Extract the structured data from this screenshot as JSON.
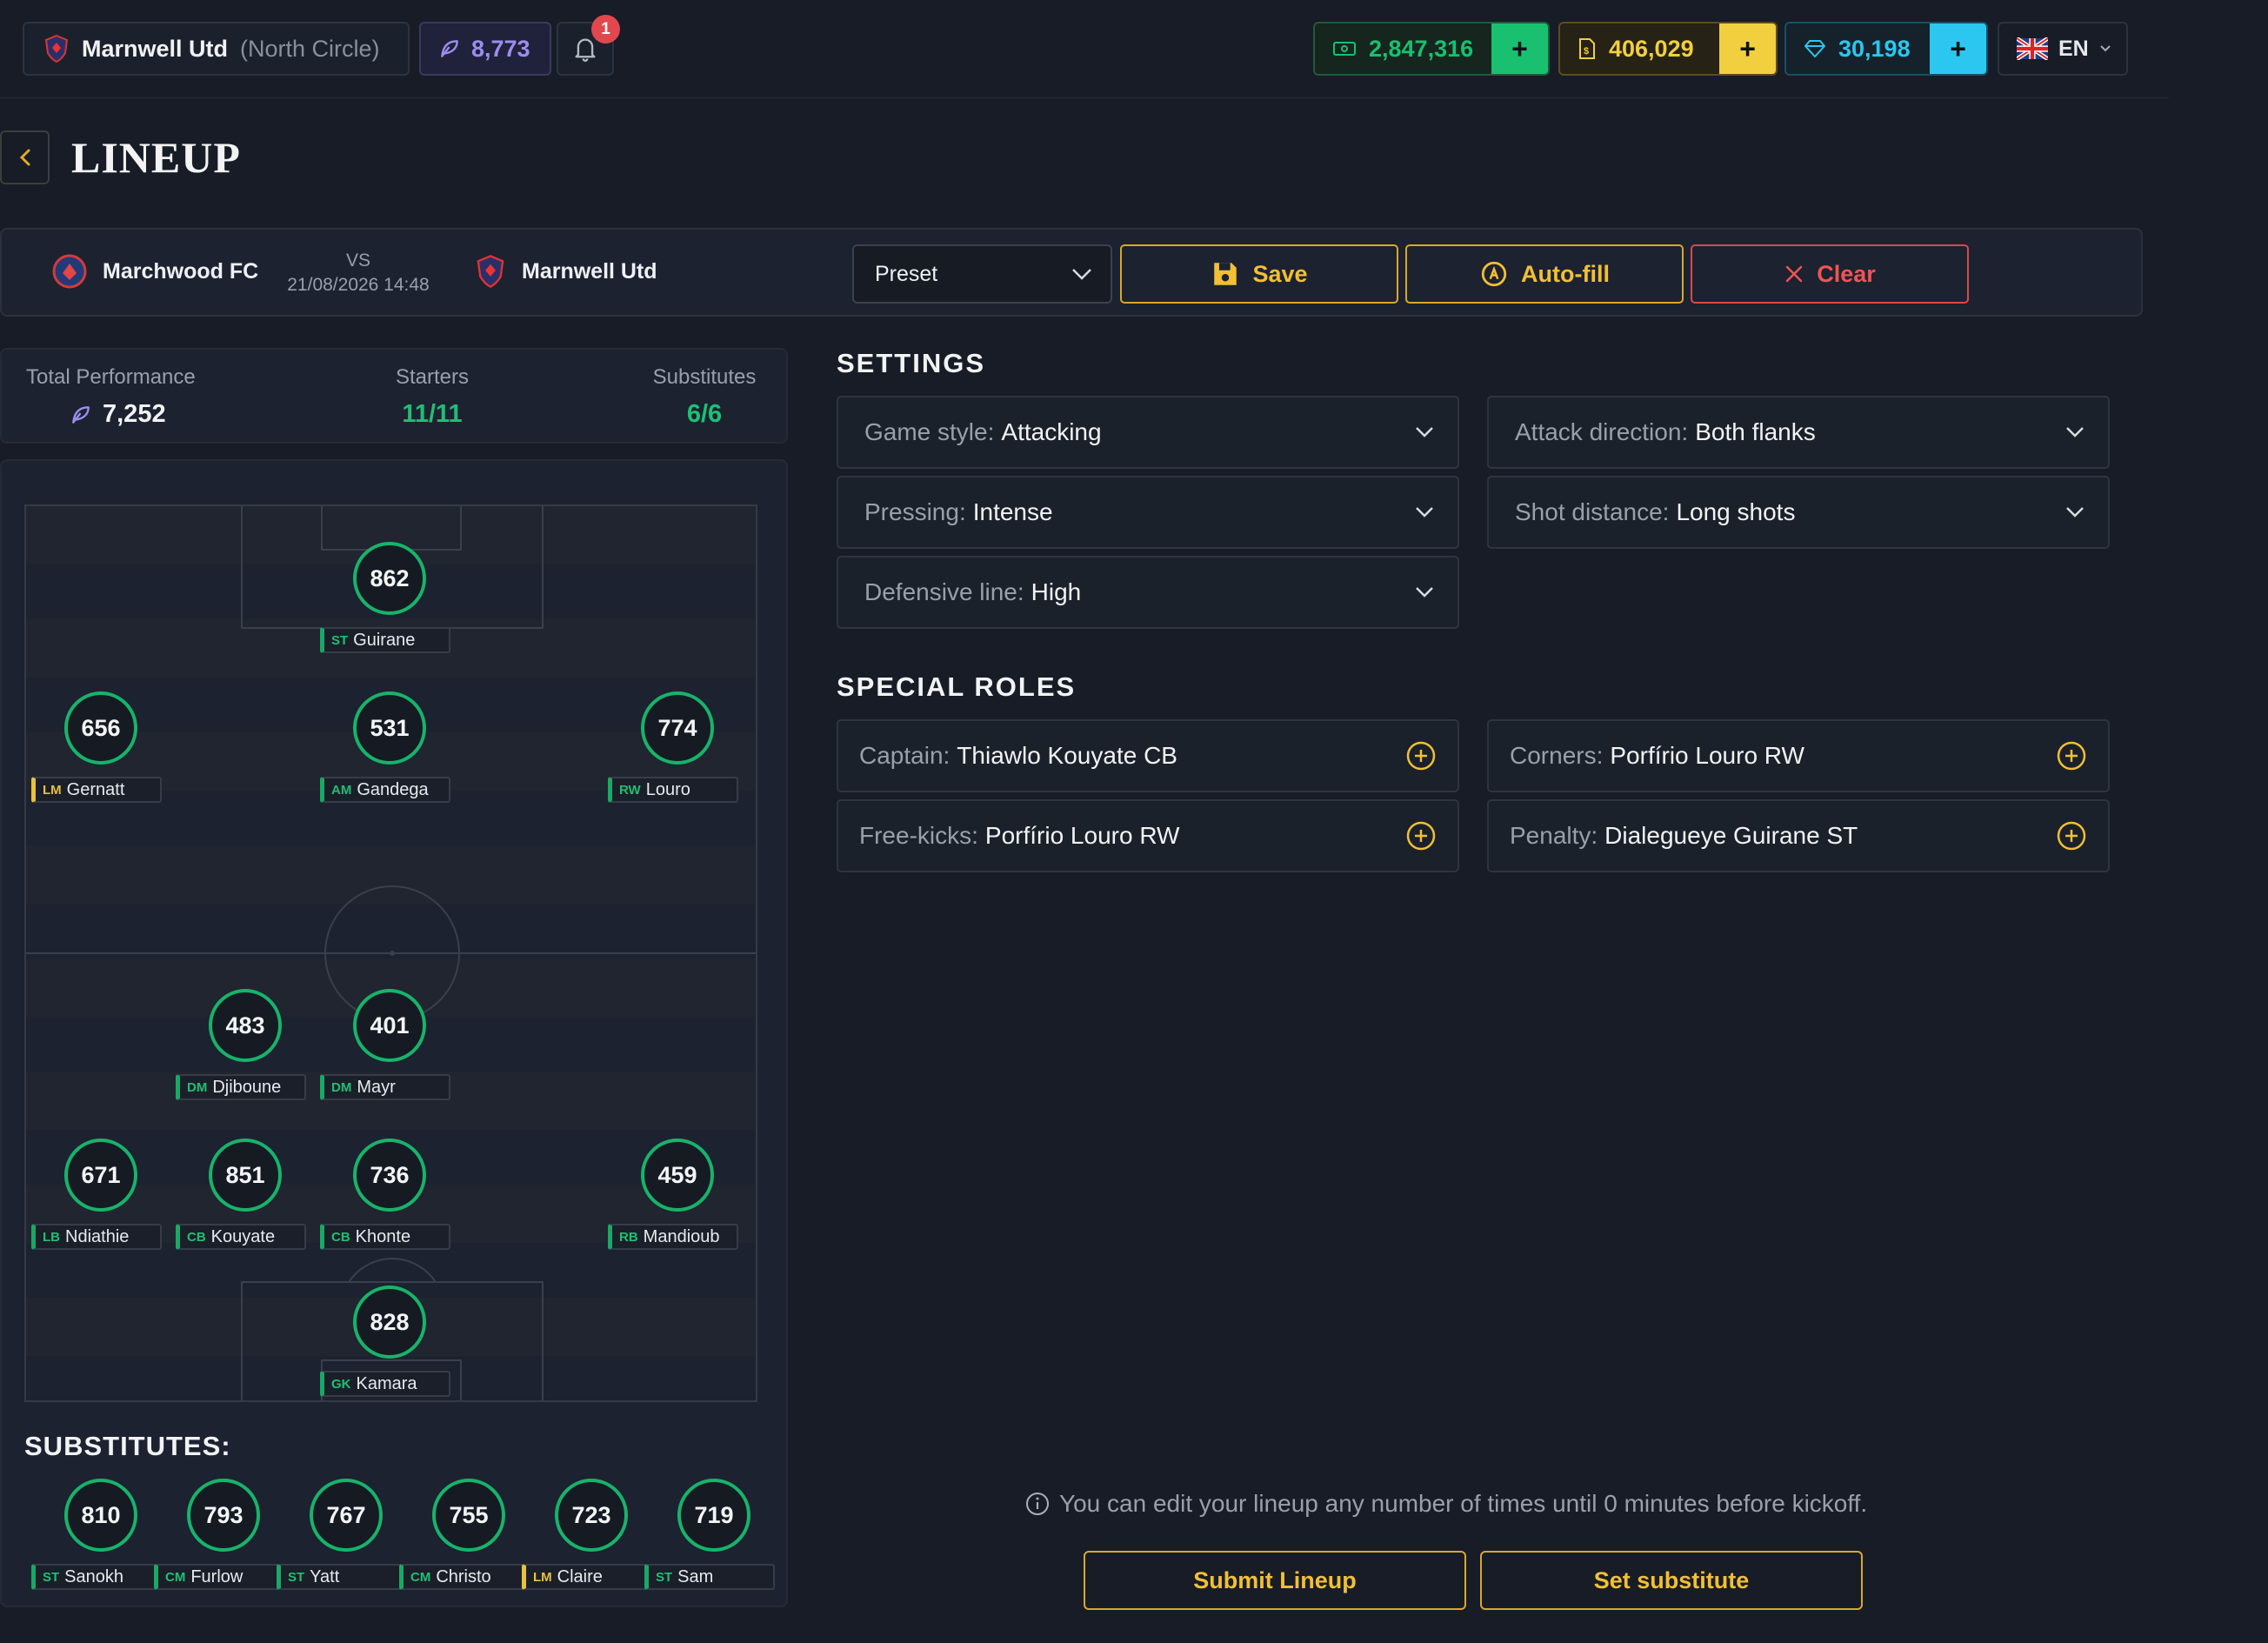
{
  "topbar": {
    "team_name": "Marnwell Utd",
    "team_region": "(North Circle)",
    "performance": "8,773",
    "notifications": "1",
    "cash": "2,847,316",
    "tokens": "406,029",
    "gems": "30,198",
    "language": "EN",
    "plus": "+"
  },
  "page": {
    "title": "LINEUP"
  },
  "match": {
    "home": "Marchwood FC",
    "vs": "VS",
    "datetime": "21/08/2026 14:48",
    "away": "Marnwell Utd",
    "preset": "Preset",
    "save": "Save",
    "autofill": "Auto-fill",
    "clear": "Clear"
  },
  "stats": {
    "total_label": "Total Performance",
    "total_value": "7,252",
    "starters_label": "Starters",
    "starters_value": "11/11",
    "subs_label": "Substitutes",
    "subs_value": "6/6"
  },
  "players": [
    {
      "rating": "862",
      "pos": "ST",
      "name": "Guirane"
    },
    {
      "rating": "656",
      "pos": "LM",
      "name": "Gernatt"
    },
    {
      "rating": "531",
      "pos": "AM",
      "name": "Gandega"
    },
    {
      "rating": "774",
      "pos": "RW",
      "name": "Louro"
    },
    {
      "rating": "483",
      "pos": "DM",
      "name": "Djiboune"
    },
    {
      "rating": "401",
      "pos": "DM",
      "name": "Mayr"
    },
    {
      "rating": "671",
      "pos": "LB",
      "name": "Ndiathie"
    },
    {
      "rating": "851",
      "pos": "CB",
      "name": "Kouyate"
    },
    {
      "rating": "736",
      "pos": "CB",
      "name": "Khonte"
    },
    {
      "rating": "459",
      "pos": "RB",
      "name": "Mandioub"
    },
    {
      "rating": "828",
      "pos": "GK",
      "name": "Kamara"
    }
  ],
  "substitutes": {
    "title": "SUBSTITUTES:",
    "list": [
      {
        "rating": "810",
        "pos": "ST",
        "name": "Sanokh"
      },
      {
        "rating": "793",
        "pos": "CM",
        "name": "Furlow"
      },
      {
        "rating": "767",
        "pos": "ST",
        "name": "Yatt"
      },
      {
        "rating": "755",
        "pos": "CM",
        "name": "Christo"
      },
      {
        "rating": "723",
        "pos": "LM",
        "name": "Claire"
      },
      {
        "rating": "719",
        "pos": "ST",
        "name": "Sam"
      }
    ]
  },
  "settings": {
    "title": "SETTINGS",
    "game_style": {
      "label": "Game style:",
      "value": "Attacking"
    },
    "attack_direction": {
      "label": "Attack direction:",
      "value": "Both flanks"
    },
    "pressing": {
      "label": "Pressing:",
      "value": "Intense"
    },
    "shot_distance": {
      "label": "Shot distance:",
      "value": "Long shots"
    },
    "defensive_line": {
      "label": "Defensive line:",
      "value": "High"
    }
  },
  "roles": {
    "title": "SPECIAL ROLES",
    "captain": {
      "label": "Captain:",
      "value": "Thiawlo Kouyate CB"
    },
    "corners": {
      "label": "Corners:",
      "value": "Porfírio Louro RW"
    },
    "freekicks": {
      "label": "Free-kicks:",
      "value": "Porfírio Louro RW"
    },
    "penalty": {
      "label": "Penalty:",
      "value": "Dialegueye Guirane ST"
    }
  },
  "footer": {
    "info": "You can edit your lineup any number of times until 0 minutes before kickoff.",
    "submit": "Submit Lineup",
    "set_sub": "Set substitute"
  },
  "colors": {
    "accent_green": "#17b36b",
    "accent_yellow": "#f2bf35",
    "accent_cyan": "#2bc7f0",
    "danger": "#e2474d"
  }
}
